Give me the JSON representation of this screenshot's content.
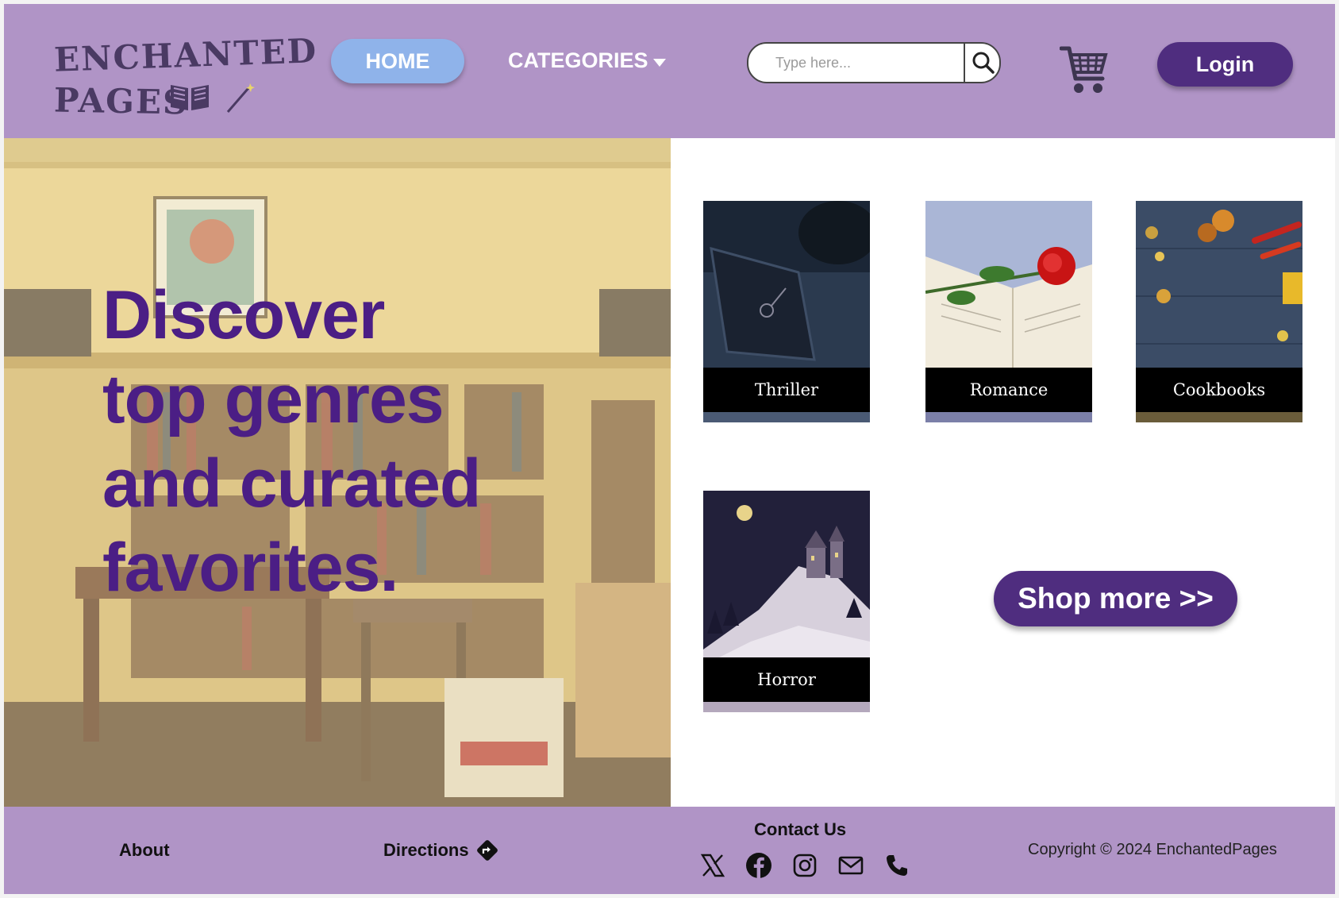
{
  "header": {
    "logo_line1": "ENCHANTED",
    "logo_line2": "PAGES",
    "nav": {
      "home": "HOME",
      "categories": "CATEGORIES"
    },
    "search": {
      "placeholder": "Type here..."
    },
    "login": "Login"
  },
  "hero": {
    "line1": "Discover",
    "line2": "top genres",
    "line3": "and curated",
    "line4": "favorites."
  },
  "categories": [
    {
      "label": "Thriller"
    },
    {
      "label": "Romance"
    },
    {
      "label": "Cookbooks"
    },
    {
      "label": "Horror"
    }
  ],
  "shop_more": "Shop more >>",
  "footer": {
    "about": "About",
    "directions": "Directions",
    "contact": "Contact Us",
    "copyright": "Copyright © 2024 EnchantedPages",
    "social_icons": [
      "x-icon",
      "facebook-icon",
      "instagram-icon",
      "mail-icon",
      "phone-icon"
    ]
  },
  "colors": {
    "header_bg": "#b094c6",
    "accent": "#4f2d7f",
    "home_button": "#8fb3ea",
    "hero_text": "#4b1e85"
  }
}
